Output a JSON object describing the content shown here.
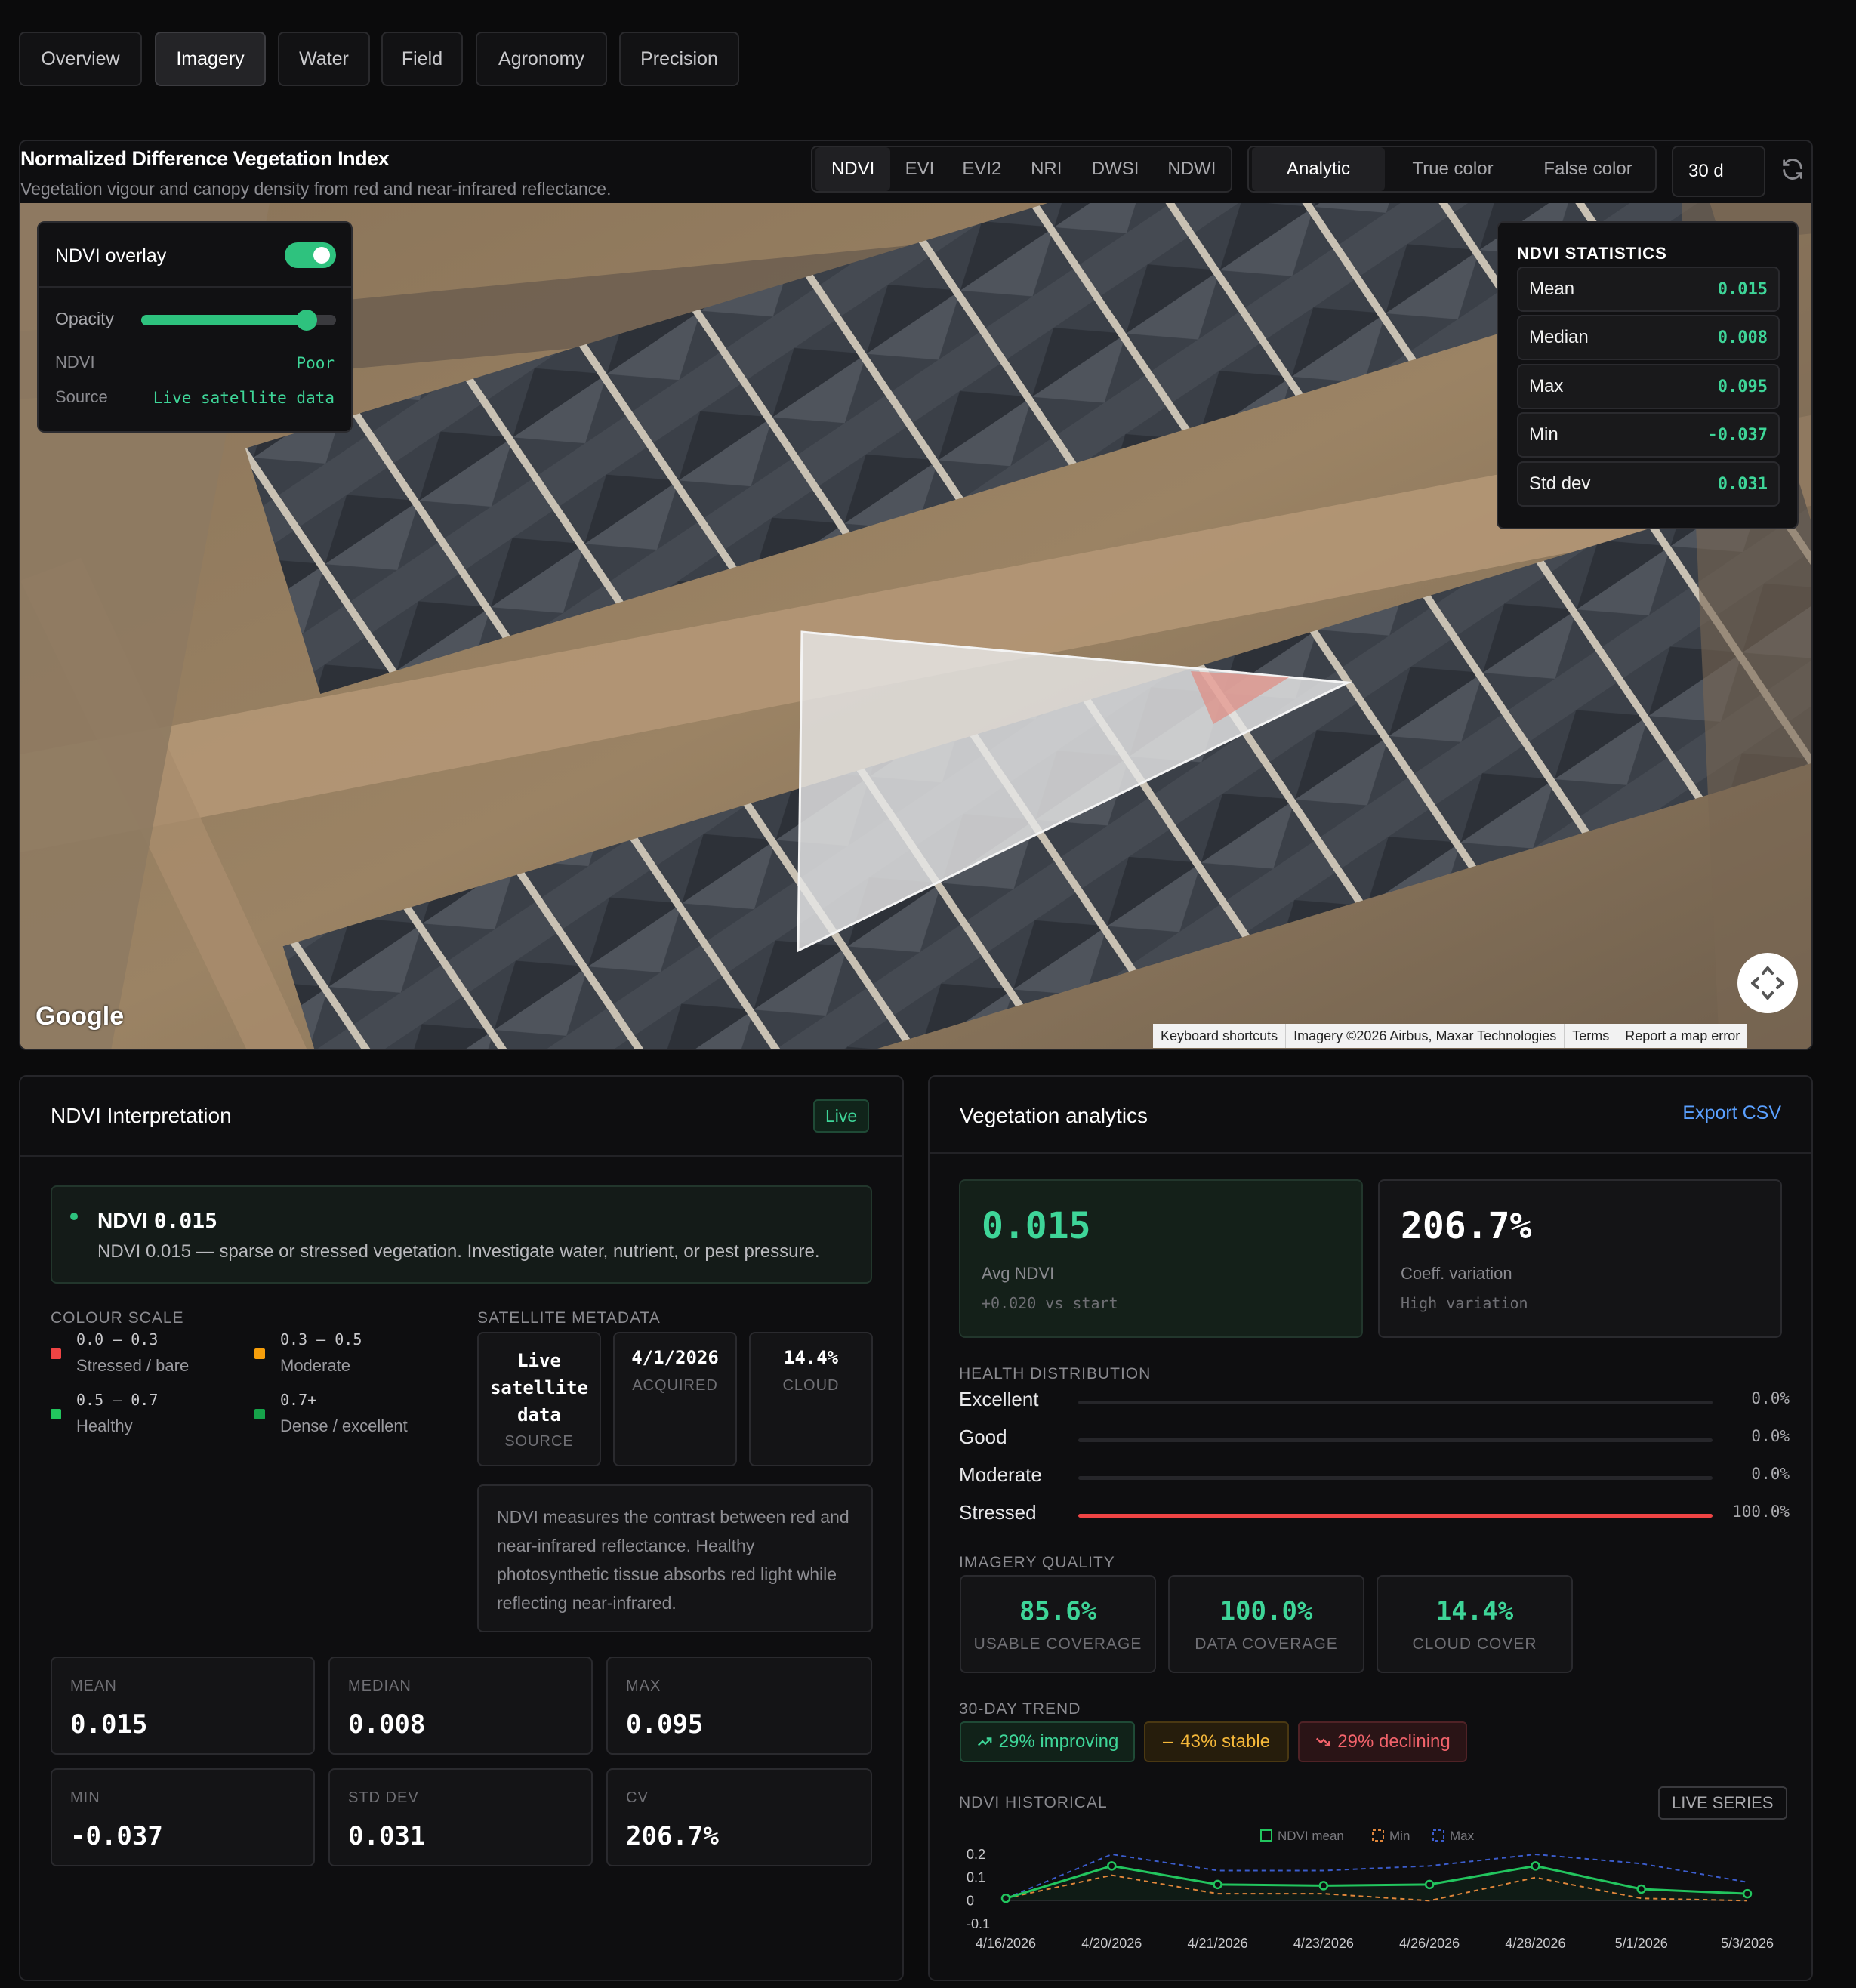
{
  "tabs": [
    "Overview",
    "Imagery",
    "Water",
    "Field",
    "Agronomy",
    "Precision"
  ],
  "active_tab": "Imagery",
  "map_header": {
    "title": "Normalized Difference Vegetation Index",
    "subtitle": "Vegetation vigour and canopy density from red and near-infrared reflectance.",
    "indices": [
      "NDVI",
      "EVI",
      "EVI2",
      "NRI",
      "DWSI",
      "NDWI"
    ],
    "active_index": "NDVI",
    "views": [
      "Analytic",
      "True color",
      "False color"
    ],
    "active_view": "Analytic",
    "range": "30 d",
    "refresh_icon": "refresh-icon"
  },
  "overlay": {
    "label": "NDVI overlay",
    "enabled": true,
    "opacity_label": "Opacity",
    "opacity": 0.85,
    "ndvi_label": "NDVI",
    "ndvi_value": "Poor",
    "source_label": "Source",
    "source_value": "Live satellite data"
  },
  "stats": {
    "title": "NDVI STATISTICS",
    "rows": [
      {
        "label": "Mean",
        "value": "0.015"
      },
      {
        "label": "Median",
        "value": "0.008"
      },
      {
        "label": "Max",
        "value": "0.095"
      },
      {
        "label": "Min",
        "value": "-0.037"
      },
      {
        "label": "Std dev",
        "value": "0.031"
      }
    ]
  },
  "map_footer": {
    "logo": "Google",
    "links": [
      "Keyboard shortcuts",
      "Imagery ©2026 Airbus, Maxar Technologies",
      "Terms",
      "Report a map error"
    ],
    "fullscreen_icon": "fullscreen-icon"
  },
  "interpretation": {
    "title": "NDVI Interpretation",
    "badge": "Live",
    "headline_label": "NDVI",
    "headline_value": "0.015",
    "description": "NDVI 0.015 — sparse or stressed vegetation. Investigate water, nutrient, or pest pressure.",
    "colour_scale_title": "COLOUR SCALE",
    "scale": [
      {
        "range": "0.0 – 0.3",
        "label": "Stressed / bare",
        "color": "#ef4444"
      },
      {
        "range": "0.3 – 0.5",
        "label": "Moderate",
        "color": "#f59e0b"
      },
      {
        "range": "0.5 – 0.7",
        "label": "Healthy",
        "color": "#22c55e"
      },
      {
        "range": "0.7+",
        "label": "Dense / excellent",
        "color": "#16a34a"
      }
    ],
    "metadata_title": "SATELLITE METADATA",
    "metadata": [
      {
        "value": "Live satellite data",
        "label": "SOURCE"
      },
      {
        "value": "4/1/2026",
        "label": "ACQUIRED"
      },
      {
        "value": "14.4%",
        "label": "CLOUD"
      }
    ],
    "note": "NDVI measures the contrast between red and near-infrared reflectance. Healthy photosynthetic tissue absorbs red light while reflecting near-infrared.",
    "metrics": [
      {
        "label": "MEAN",
        "value": "0.015"
      },
      {
        "label": "MEDIAN",
        "value": "0.008"
      },
      {
        "label": "MAX",
        "value": "0.095"
      },
      {
        "label": "MIN",
        "value": "-0.037"
      },
      {
        "label": "STD DEV",
        "value": "0.031"
      },
      {
        "label": "CV",
        "value": "206.7%"
      }
    ]
  },
  "analytics": {
    "title": "Vegetation analytics",
    "export": "Export CSV",
    "avg_value": "0.015",
    "avg_label": "Avg NDVI",
    "avg_delta": "+0.020 vs start",
    "cv_value": "206.7%",
    "cv_label": "Coeff. variation",
    "cv_note": "High variation",
    "health_title": "HEALTH DISTRIBUTION",
    "health": [
      {
        "label": "Excellent",
        "pct": "0.0%",
        "value": 0.0
      },
      {
        "label": "Good",
        "pct": "0.0%",
        "value": 0.0
      },
      {
        "label": "Moderate",
        "pct": "0.0%",
        "value": 0.0
      },
      {
        "label": "Stressed",
        "pct": "100.0%",
        "value": 100.0
      }
    ],
    "quality_title": "IMAGERY QUALITY",
    "quality": [
      {
        "value": "85.6%",
        "label": "USABLE COVERAGE"
      },
      {
        "value": "100.0%",
        "label": "DATA COVERAGE"
      },
      {
        "value": "14.4%",
        "label": "CLOUD COVER"
      }
    ],
    "trend_title": "30-DAY TREND",
    "trends": [
      {
        "label": "29% improving",
        "color": "#3ed598"
      },
      {
        "label": "43% stable",
        "color": "#f5b83a"
      },
      {
        "label": "29% declining",
        "color": "#f2636b"
      }
    ],
    "historical_title": "NDVI HISTORICAL",
    "live_series": "LIVE SERIES",
    "colors": {
      "mean": "#22c55e",
      "min": "#e0863a",
      "max": "#3b5ccc"
    }
  },
  "chart_data": {
    "type": "line",
    "x": [
      "4/16/2026",
      "4/20/2026",
      "4/21/2026",
      "4/23/2026",
      "4/26/2026",
      "4/28/2026",
      "5/1/2026",
      "5/3/2026"
    ],
    "series": [
      {
        "name": "NDVI mean",
        "values": [
          0.01,
          0.15,
          0.07,
          0.065,
          0.07,
          0.15,
          0.05,
          0.03
        ]
      },
      {
        "name": "Min",
        "values": [
          0.01,
          0.11,
          0.03,
          0.03,
          0.0,
          0.1,
          0.01,
          0.0
        ]
      },
      {
        "name": "Max",
        "values": [
          0.01,
          0.2,
          0.13,
          0.13,
          0.15,
          0.2,
          0.16,
          0.08
        ]
      }
    ],
    "yticks": [
      "0.2",
      "0.1",
      "0",
      "-0.1"
    ],
    "ylim": [
      -0.1,
      0.2
    ],
    "legend": [
      "NDVI mean",
      "Min",
      "Max"
    ],
    "legend_position": "top-center"
  }
}
